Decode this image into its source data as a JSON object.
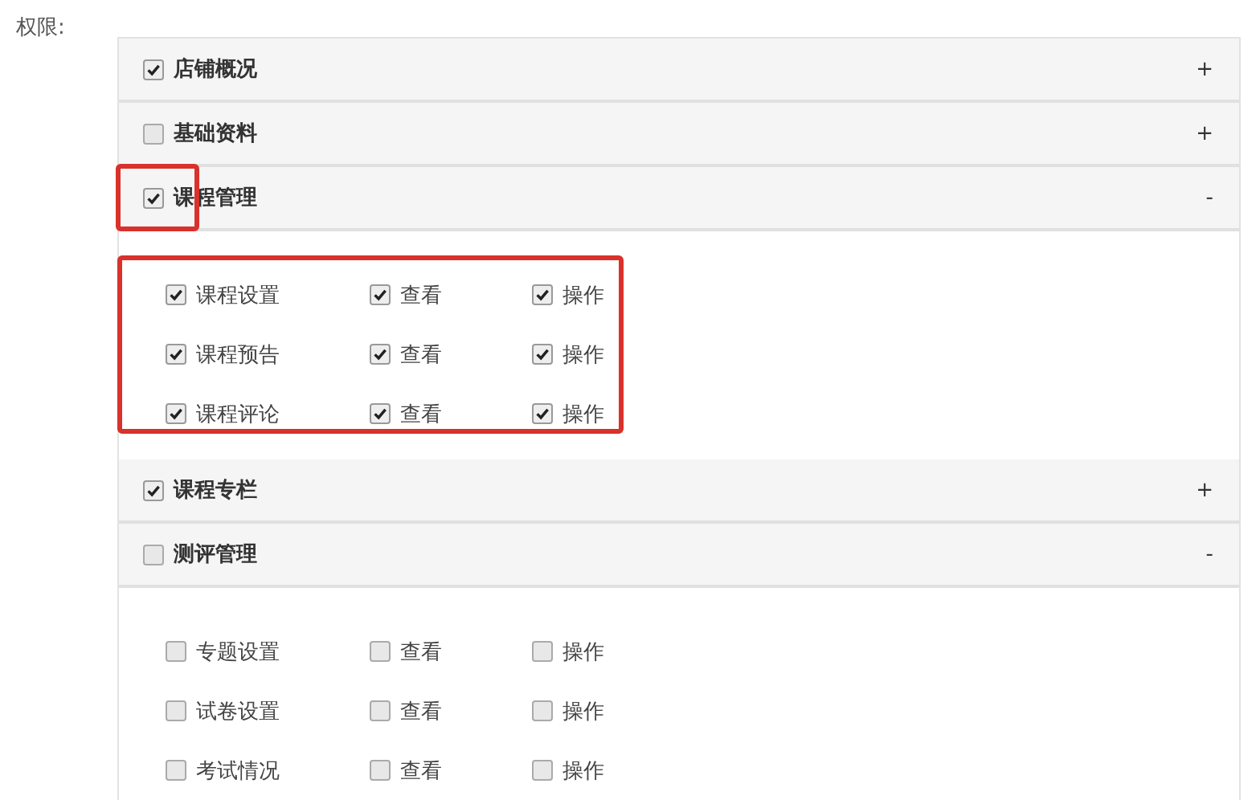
{
  "field_label": "权限:",
  "sections": [
    {
      "title": "店铺概况",
      "checked": true,
      "toggle": "+"
    },
    {
      "title": "基础资料",
      "checked": false,
      "toggle": "+"
    },
    {
      "title": "课程管理",
      "checked": true,
      "toggle": "-",
      "highlighted": true,
      "body_highlighted": true,
      "rows": [
        {
          "items": [
            {
              "label": "课程设置",
              "checked": true
            },
            {
              "label": "查看",
              "checked": true
            },
            {
              "label": "操作",
              "checked": true
            }
          ]
        },
        {
          "items": [
            {
              "label": "课程预告",
              "checked": true
            },
            {
              "label": "查看",
              "checked": true
            },
            {
              "label": "操作",
              "checked": true
            }
          ]
        },
        {
          "items": [
            {
              "label": "课程评论",
              "checked": true
            },
            {
              "label": "查看",
              "checked": true
            },
            {
              "label": "操作",
              "checked": true
            }
          ]
        }
      ]
    },
    {
      "title": "课程专栏",
      "checked": true,
      "toggle": "+"
    },
    {
      "title": "测评管理",
      "checked": false,
      "toggle": "-",
      "rows": [
        {
          "items": [
            {
              "label": "专题设置",
              "checked": false
            },
            {
              "label": "查看",
              "checked": false
            },
            {
              "label": "操作",
              "checked": false
            }
          ]
        },
        {
          "items": [
            {
              "label": "试卷设置",
              "checked": false
            },
            {
              "label": "查看",
              "checked": false
            },
            {
              "label": "操作",
              "checked": false
            }
          ]
        },
        {
          "items": [
            {
              "label": "考试情况",
              "checked": false
            },
            {
              "label": "查看",
              "checked": false
            },
            {
              "label": "操作",
              "checked": false
            }
          ]
        }
      ]
    }
  ]
}
